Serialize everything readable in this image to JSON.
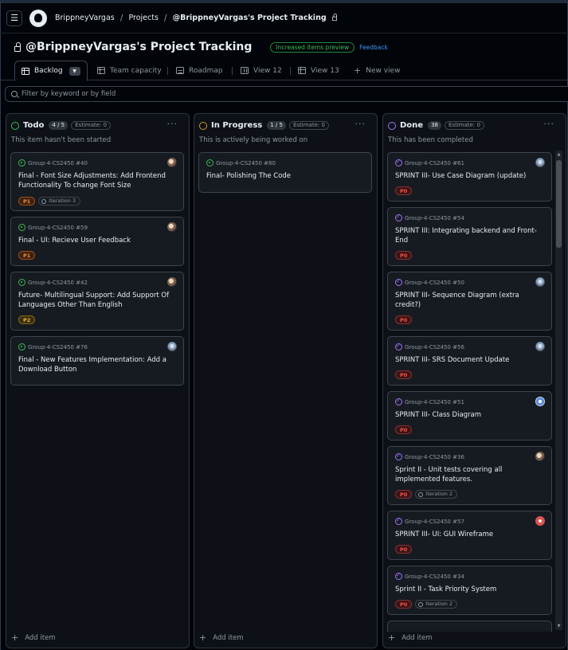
{
  "breadcrumbs": [
    "BrippneyVargas",
    "Projects",
    "@BrippneyVargas's Project Tracking"
  ],
  "title": "@BrippneyVargas's Project Tracking",
  "preview_badge": "Increased items preview",
  "feedback": "Feedback",
  "views": [
    {
      "label": "Backlog",
      "icon": "table-icon"
    },
    {
      "label": "Team capacity",
      "icon": "table-icon"
    },
    {
      "label": "Roadmap",
      "icon": "roadmap-icon"
    },
    {
      "label": "View 12",
      "icon": "board-icon"
    },
    {
      "label": "View 13",
      "icon": "table-icon"
    },
    {
      "label": "New view",
      "icon": "plus-icon"
    }
  ],
  "filter_placeholder": "Filter by keyword or by field",
  "add_item": "Add item",
  "columns": [
    {
      "name": "Todo",
      "count": "4 / 5",
      "estimate": "Estimate: 0",
      "description": "This item hasn't been started",
      "color": "#3fb950",
      "cards": [
        {
          "ref": "Group-4-CS2450 #40",
          "title": "Final - Font Size Adjustments: Add Frontend Functionality To change Font Size",
          "priority": "P1",
          "iteration": "Iteration 3"
        },
        {
          "ref": "Group-4-CS2450 #59",
          "title": "Final - UI: Recieve User Feedback",
          "priority": "P1"
        },
        {
          "ref": "Group-4-CS2450 #42",
          "title": "Future- Multilingual Support: Add Support Of Languages Other Than English",
          "priority": "P2"
        },
        {
          "ref": "Group-4-CS2450 #76",
          "title": "Final - New Features Implementation: Add a Download Button"
        }
      ]
    },
    {
      "name": "In Progress",
      "count": "1 / 5",
      "estimate": "Estimate: 0",
      "description": "This is actively being worked on",
      "color": "#d29922",
      "cards": [
        {
          "ref": "Group-4-CS2450 #80",
          "title": "Final- Polishing The Code"
        }
      ]
    },
    {
      "name": "Done",
      "count": "38",
      "estimate": "Estimate: 0",
      "description": "This has been completed",
      "color": "#a371f7",
      "cards": [
        {
          "ref": "Group-4-CS2450 #61",
          "title": "SPRINT III- Use Case Diagram (update)",
          "priority": "P0"
        },
        {
          "ref": "Group-4-CS2450 #54",
          "title": "SPRINT III: Integrating backend and Front-End",
          "priority": "P0"
        },
        {
          "ref": "Group-4-CS2450 #50",
          "title": "SPRINT III- Sequence Diagram (extra credit?)",
          "priority": "P0"
        },
        {
          "ref": "Group-4-CS2450 #56",
          "title": "SPRINT III- SRS Document Update",
          "priority": "P0"
        },
        {
          "ref": "Group-4-CS2450 #51",
          "title": "SPRINT III- Class Diagram",
          "priority": "P0"
        },
        {
          "ref": "Group-4-CS2450 #36",
          "title": "Sprint II - Unit tests covering all implemented features.",
          "priority": "P0",
          "iteration": "Iteration 2"
        },
        {
          "ref": "Group-4-CS2450 #57",
          "title": "SPRINT III- UI: GUI Wireframe",
          "priority": "P0"
        },
        {
          "ref": "Group-4-CS2450 #34",
          "title": "Sprint II - Task Priority System",
          "priority": "P0",
          "iteration": "Iteration 2"
        }
      ]
    }
  ]
}
